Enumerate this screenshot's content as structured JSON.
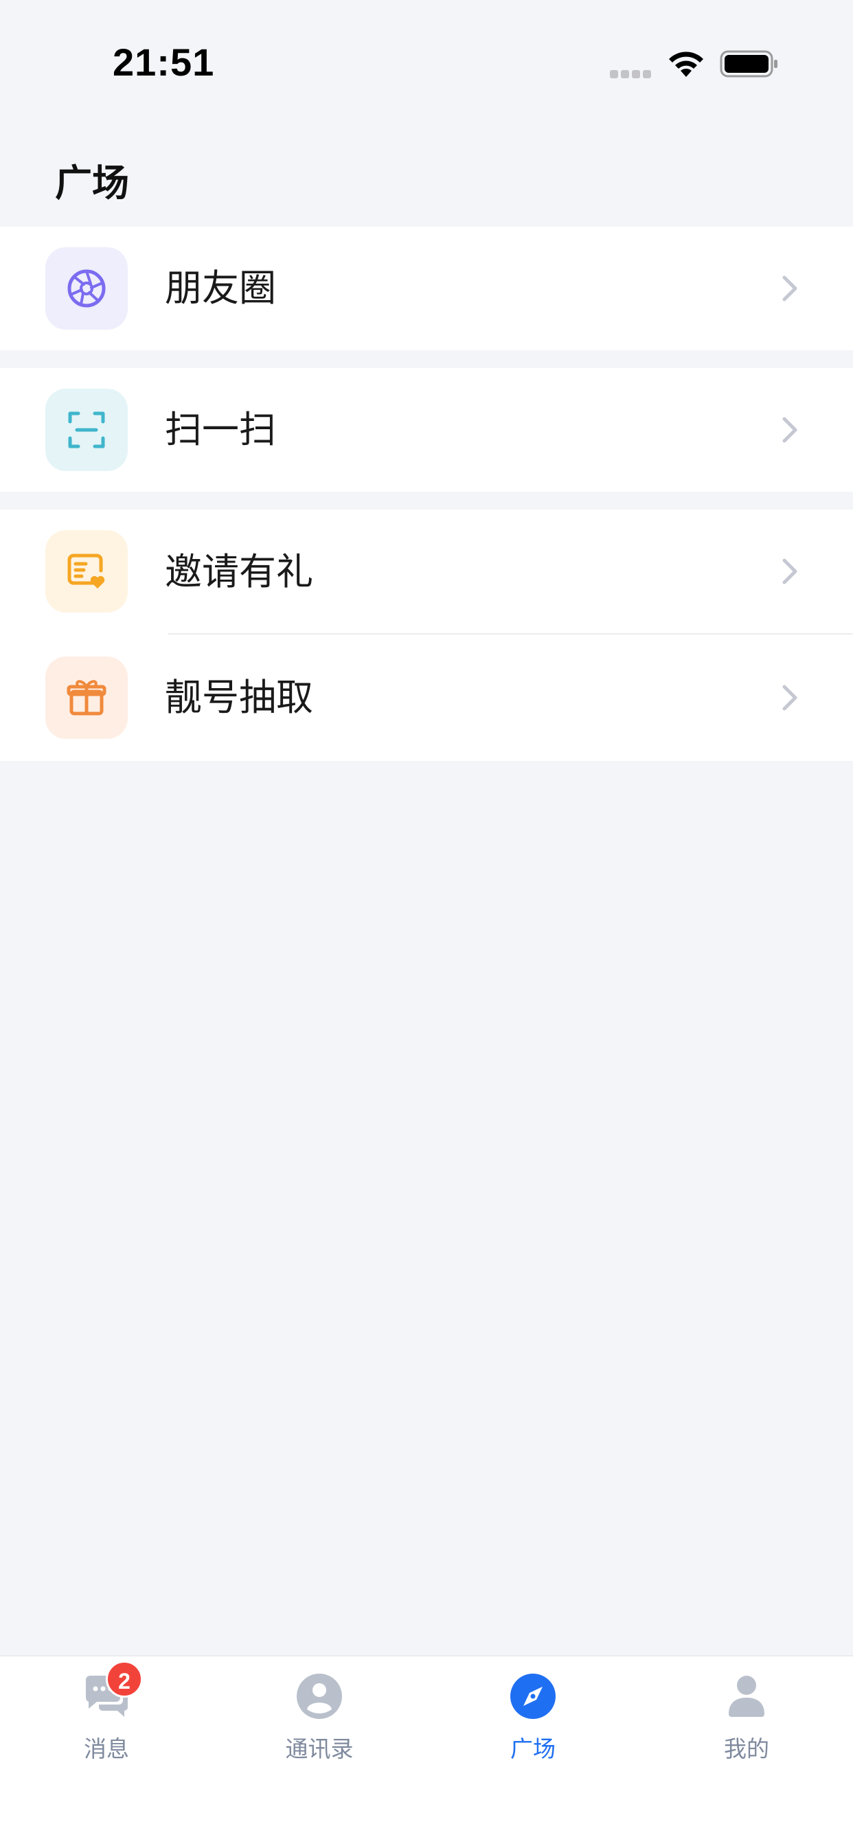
{
  "status_bar": {
    "time": "21:51"
  },
  "header": {
    "title": "广场"
  },
  "groups": [
    {
      "items": [
        {
          "label": "朋友圈",
          "icon": "aperture-icon",
          "icon_color": "#7b6cf0",
          "icon_bg": "#eeeefc"
        }
      ]
    },
    {
      "items": [
        {
          "label": "扫一扫",
          "icon": "scan-icon",
          "icon_color": "#3fb6cc",
          "icon_bg": "#e4f4f7"
        }
      ]
    },
    {
      "items": [
        {
          "label": "邀请有礼",
          "icon": "invite-card-icon",
          "icon_color": "#f5a623",
          "icon_bg": "#fff4e2"
        },
        {
          "label": "靓号抽取",
          "icon": "gift-icon",
          "icon_color": "#f08a3c",
          "icon_bg": "#ffeee4"
        }
      ]
    }
  ],
  "tab_bar": {
    "tabs": [
      {
        "label": "消息",
        "icon": "chat-icon",
        "badge": "2"
      },
      {
        "label": "通讯录",
        "icon": "contacts-icon"
      },
      {
        "label": "广场",
        "icon": "compass-icon",
        "active": true
      },
      {
        "label": "我的",
        "icon": "person-icon"
      }
    ],
    "active_color": "#1f6ff2",
    "inactive_color": "#7f8a9e"
  }
}
